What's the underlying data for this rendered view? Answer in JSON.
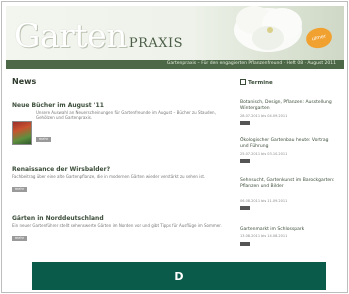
{
  "header": {
    "logo_main": "Garten",
    "logo_sub": "PRAXIS",
    "badge": "ulmer",
    "tagline": "Gartenpraxis – Für den engagierten Pflanzenfreund · Heft 08 · August 2011"
  },
  "news": {
    "heading": "News",
    "articles": [
      {
        "title": "Neue Bücher im August '11",
        "text": "Unsere Auswahl an Neuerscheinungen für Gartenfreunde im August – Bücher zu Stauden, Gehölzen und Gartenpraxis.",
        "more": "mehr"
      },
      {
        "title": "Renaissance der Wirsbalder?",
        "text": "Fachbeitrag über eine alte Gartenpflanze, die in modernen Gärten wieder verstärkt zu sehen ist.",
        "more": "mehr"
      },
      {
        "title": "Gärten in Norddeutschland",
        "text": "Ein neuer Gartenführer stellt sehenswerte Gärten im Norden vor und gibt Tipps für Ausflüge im Sommer.",
        "more": "mehr"
      }
    ]
  },
  "calendar": {
    "heading": "Termine",
    "events": [
      {
        "title": "Botanisch, Design, Pflanzen: Ausstellung Wintergarten",
        "date": "28.07.2011 bis 04.09.2011"
      },
      {
        "title": "Ökologischer Gartenbau heute: Vortrag und Führung",
        "date": "25.07.2011 bis 03.10.2011"
      },
      {
        "title": "Sehnsucht, Gartenkunst im Barockgarten: Pflanzen und Bilder",
        "date": "06.08.2011 bis 11.09.2011"
      },
      {
        "title": "Gartenmarkt im Schlosspark",
        "date": "13.08.2011 bis 14.08.2011"
      }
    ]
  },
  "overlay": {
    "label": "D"
  }
}
